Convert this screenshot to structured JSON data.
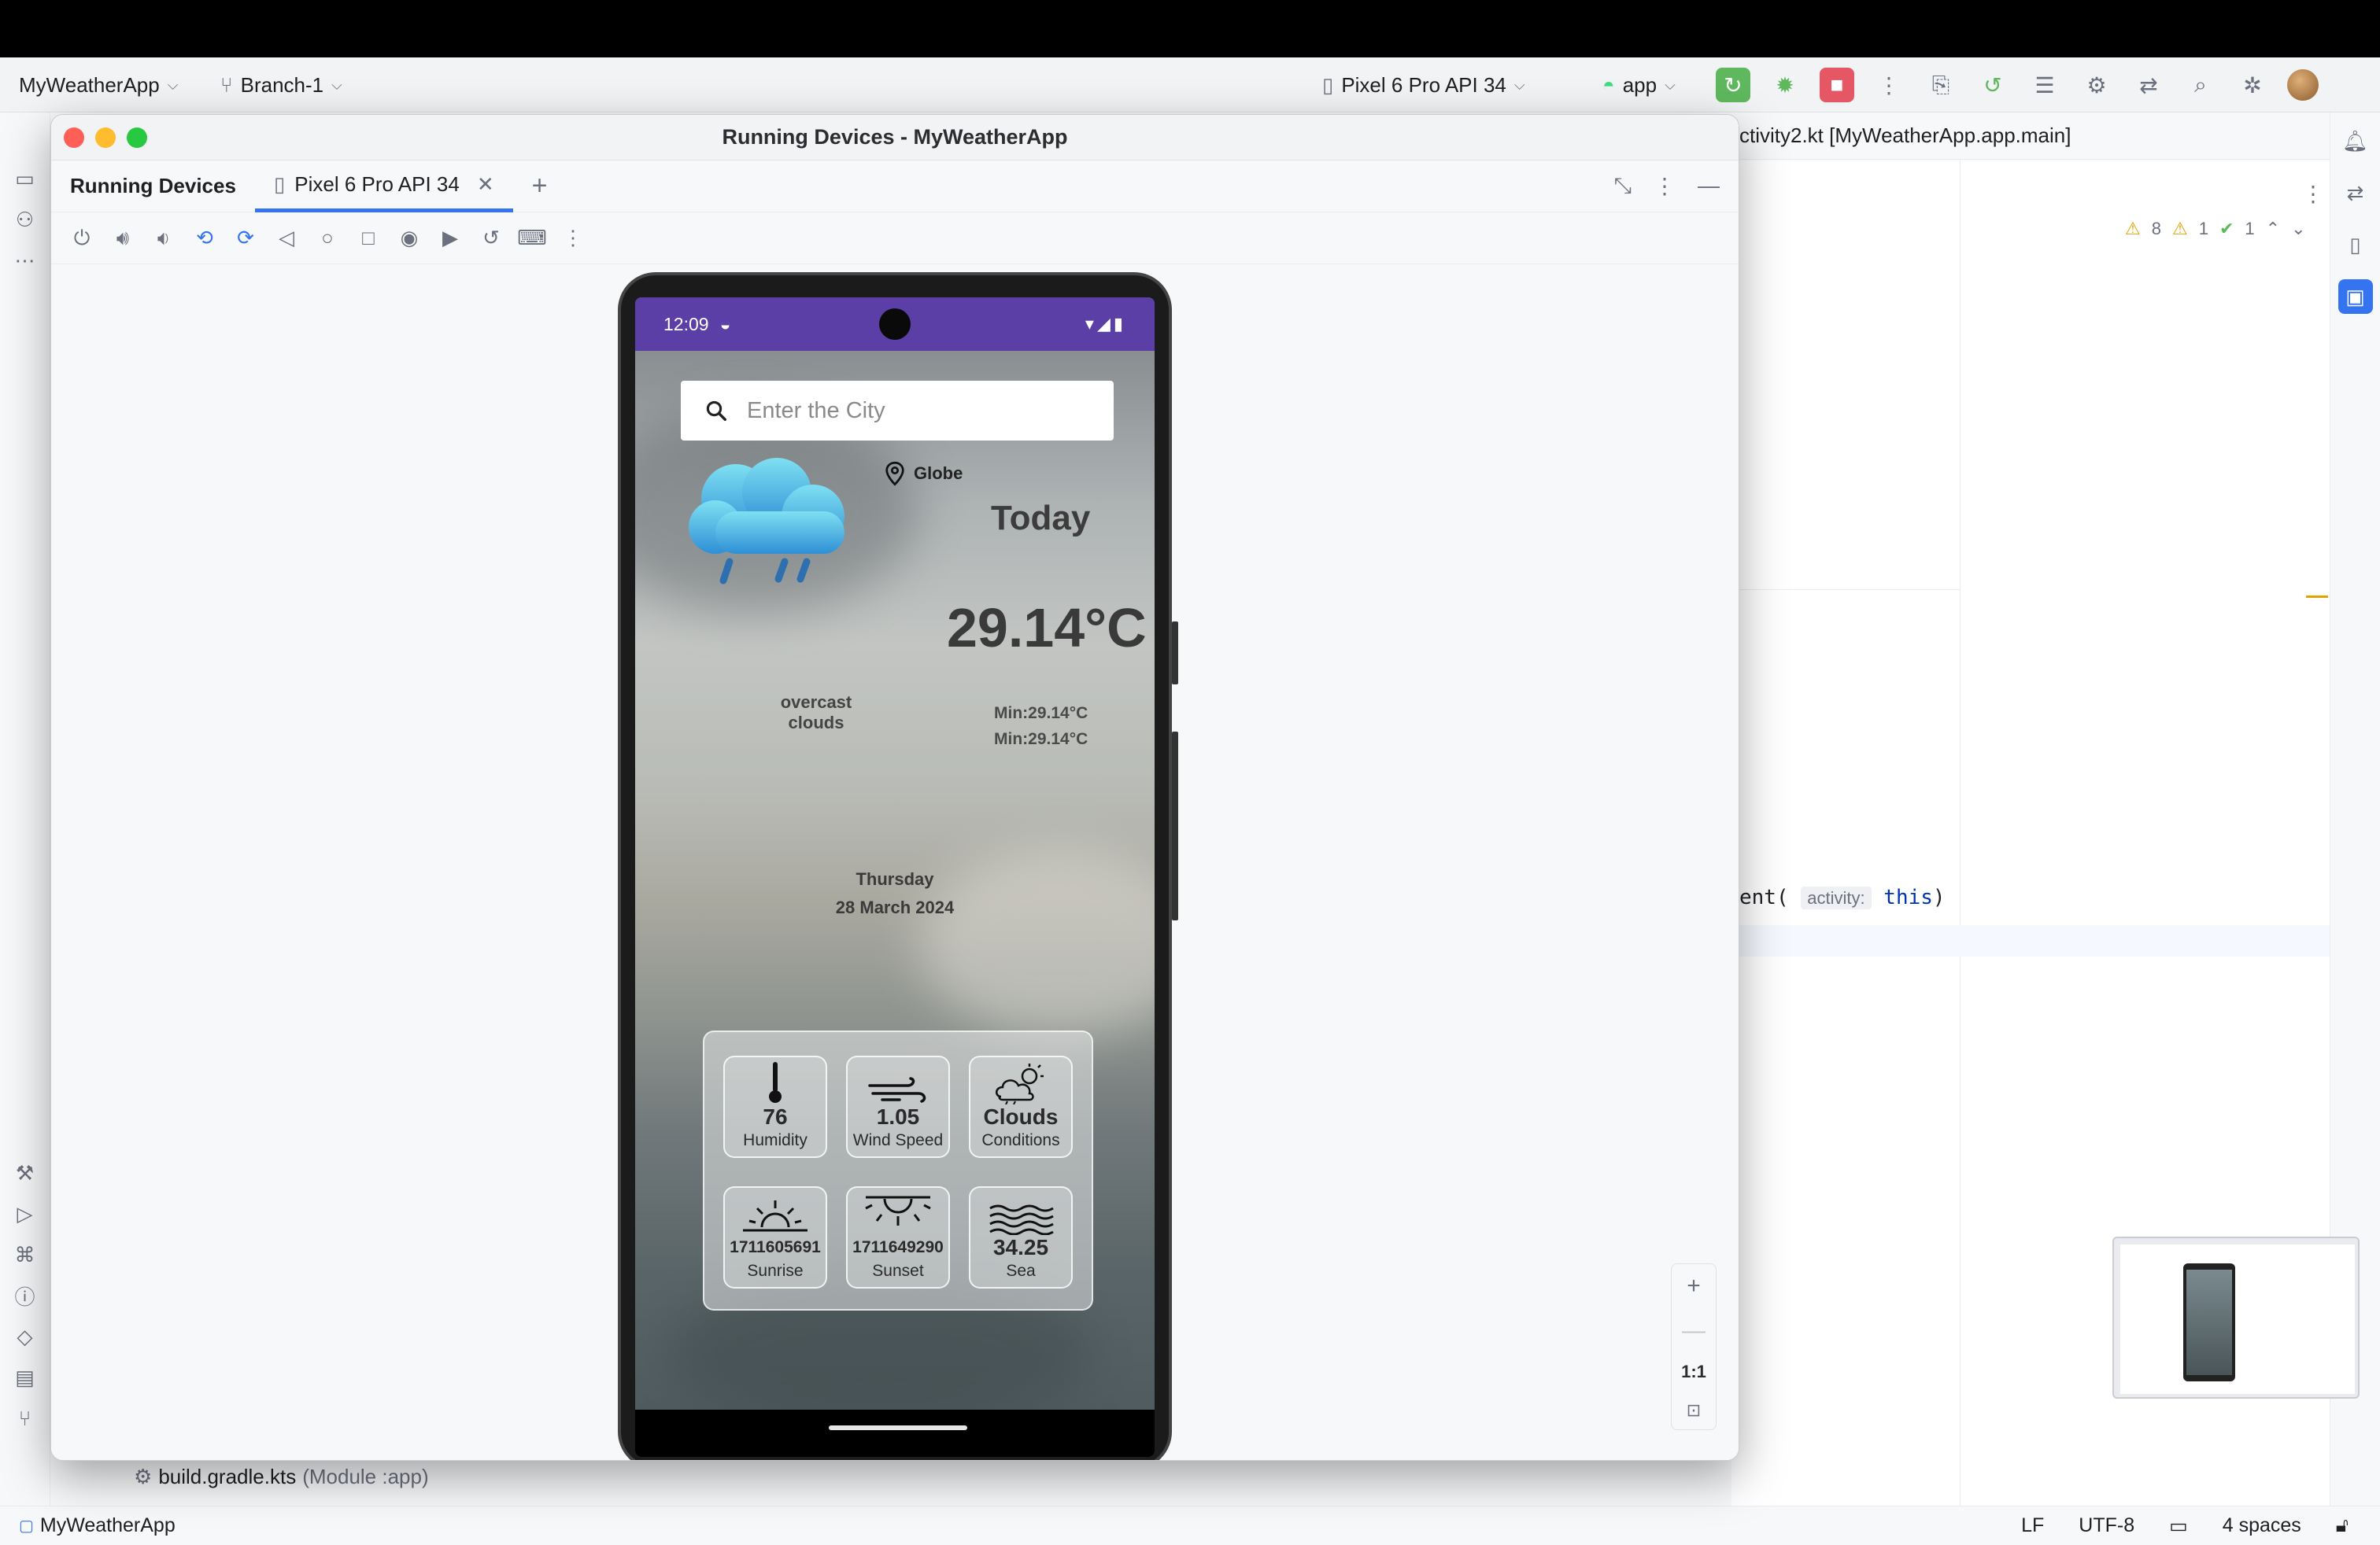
{
  "ide": {
    "project_name": "MyWeatherApp",
    "branch": "Branch-1",
    "device_selector": "Pixel 6 Pro API 34",
    "run_config": "app",
    "editor_tab": "ctivity2.kt [MyWeatherApp.app.main]",
    "code_fragment_prefix": "ent(",
    "code_hint": "activity:",
    "code_keyword": "this",
    "code_suffix": ")",
    "inspections": {
      "warnings": "8",
      "weak_warnings": "1",
      "ok": "1"
    },
    "project_file": "build.gradle.kts",
    "project_file_module": "(Module :app)",
    "status": {
      "project": "MyWeatherApp",
      "line_sep": "LF",
      "encoding": "UTF-8",
      "indent": "4 spaces"
    }
  },
  "running_devices": {
    "window_title": "Running Devices - MyWeatherApp",
    "panel_tab": "Running Devices",
    "device_tab": "Pixel 6 Pro API 34",
    "zoom": {
      "plus": "+",
      "minus": "—",
      "one_to_one": "1:1"
    }
  },
  "phone": {
    "time": "12:09",
    "search_placeholder": "Enter the City",
    "location": "Globe",
    "day_label": "Today",
    "temperature": "29.14°C",
    "condition_line1": "overcast",
    "condition_line2": "clouds",
    "min_line1": "Min:29.14°C",
    "min_line2": "Min:29.14°C",
    "weekday": "Thursday",
    "date": "28 March 2024",
    "cards": [
      {
        "value": "76",
        "label": "Humidity",
        "icon": "thermometer-icon"
      },
      {
        "value": "1.05",
        "label": "Wind Speed",
        "icon": "wind-icon"
      },
      {
        "value": "Clouds",
        "label": "Conditions",
        "icon": "cloud-sun-icon"
      },
      {
        "value": "1711605691",
        "label": "Sunrise",
        "icon": "sunrise-icon"
      },
      {
        "value": "1711649290",
        "label": "Sunset",
        "icon": "sunset-icon"
      },
      {
        "value": "34.25",
        "label": "Sea",
        "icon": "waves-icon"
      }
    ]
  },
  "colors": {
    "status_bar": "#5b3fa6",
    "accent": "#3574f0",
    "run": "#5fb85d",
    "stop": "#e55765"
  }
}
